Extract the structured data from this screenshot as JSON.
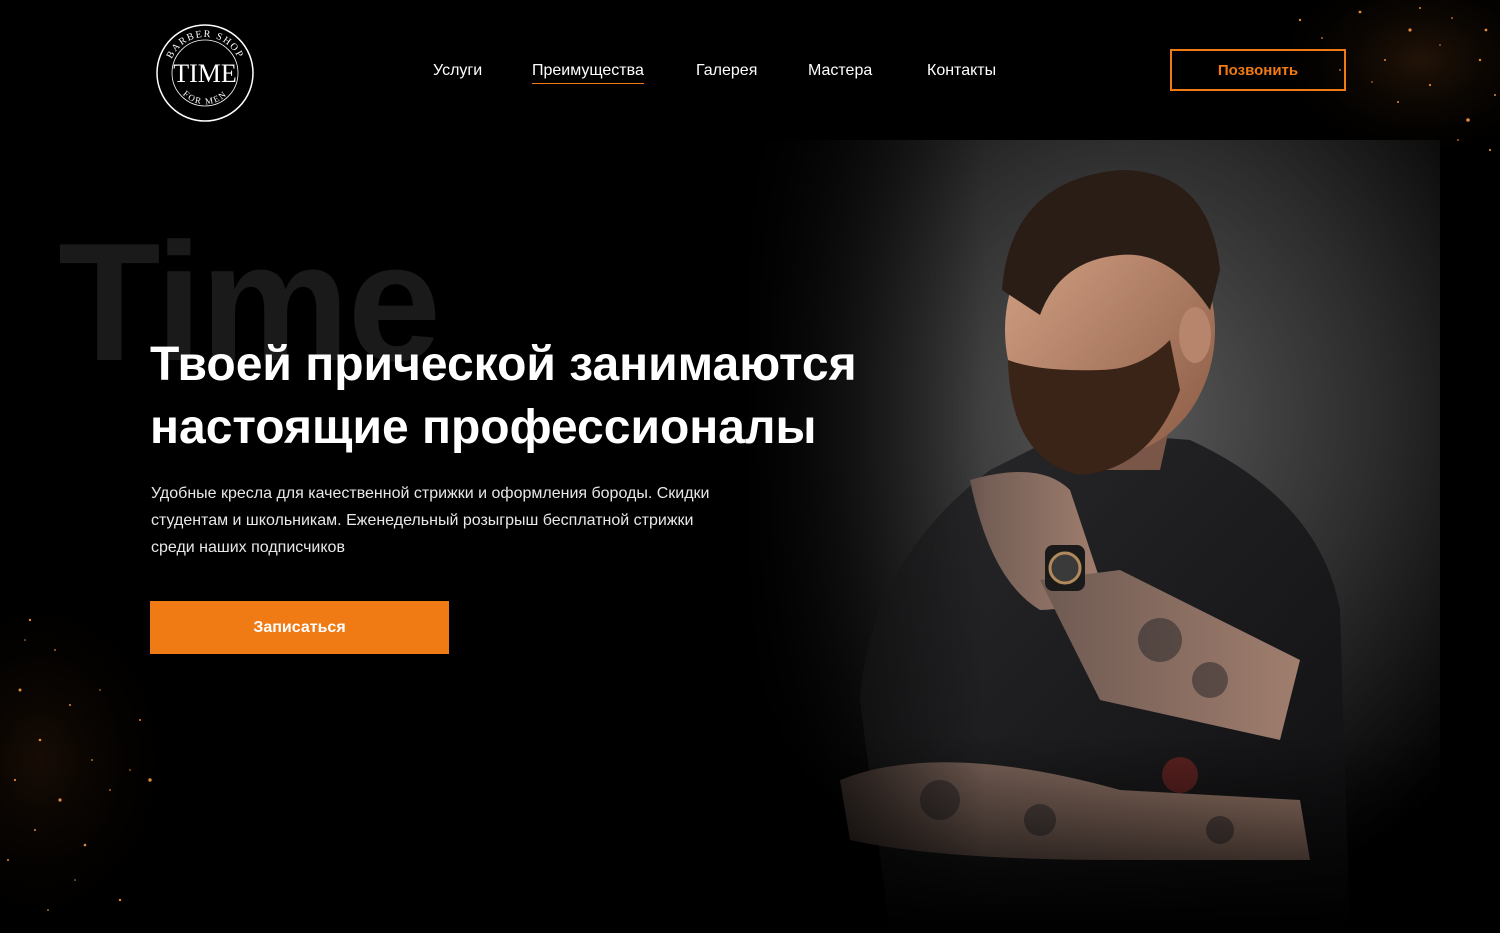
{
  "brand": {
    "name": "TIME",
    "ring_top": "BARBER SHOP",
    "ring_bottom": "FOR MEN"
  },
  "nav": {
    "items": [
      {
        "label": "Услуги",
        "active": false
      },
      {
        "label": "Преимущества",
        "active": true
      },
      {
        "label": "Галерея",
        "active": false
      },
      {
        "label": "Мастера",
        "active": false
      },
      {
        "label": "Контакты",
        "active": false
      }
    ]
  },
  "header": {
    "call_label": "Позвонить"
  },
  "hero": {
    "ghost_word": "Time",
    "headline_line1": "Твоей прической занимаются",
    "headline_line2": "настоящие профессионалы",
    "lead_line1": "Удобные кресла для качественной стрижки и оформления бороды.  Скидки",
    "lead_line2": "студентам и школьникам. Еженедельный розыгрыш бесплатной стрижки",
    "lead_line3": "среди наших подписчиков",
    "cta_label": "Записаться"
  },
  "colors": {
    "accent": "#f07a13",
    "background": "#000000",
    "text": "#ffffff"
  }
}
